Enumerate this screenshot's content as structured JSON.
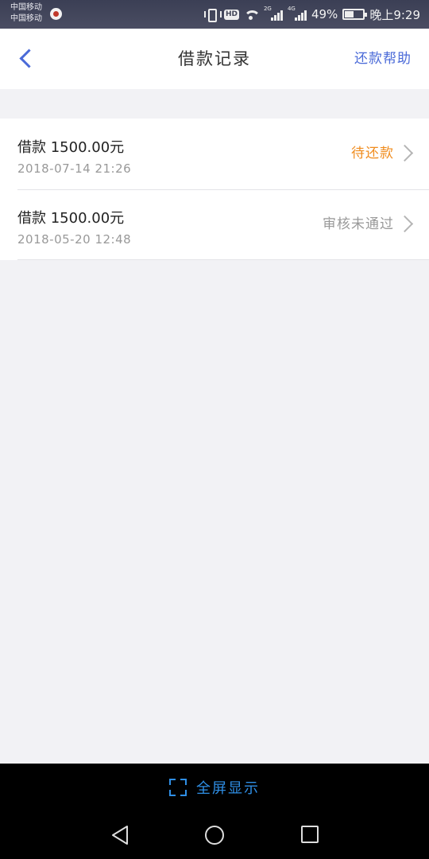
{
  "status_bar": {
    "carrier_1": "中国移动",
    "carrier_2": "中国移动",
    "net_1": "2G",
    "net_2": "4G",
    "battery_text": "49%",
    "battery_level": 0.49,
    "time": "晚上9:29",
    "icons": [
      "carrier-icon",
      "vibrate-icon",
      "hd-icon",
      "wifi-icon",
      "signal-icon",
      "signal-icon",
      "battery-icon"
    ]
  },
  "header": {
    "title": "借款记录",
    "help": "还款帮助",
    "back_icon": "chevron-left-icon",
    "accent": "#4a6ad8"
  },
  "records": [
    {
      "amount": "借款 1500.00元",
      "time": "2018-07-14 21:26",
      "status": "待还款",
      "status_color": "#f08c1e"
    },
    {
      "amount": "借款 1500.00元",
      "time": "2018-05-20 12:48",
      "status": "审核未通过",
      "status_color": "#999999"
    }
  ],
  "fullscreen": {
    "label": "全屏显示",
    "icon": "expand-icon",
    "color": "#2f8fe6"
  },
  "nav": {
    "icons": [
      "nav-back-icon",
      "nav-home-icon",
      "nav-recent-icon"
    ]
  }
}
